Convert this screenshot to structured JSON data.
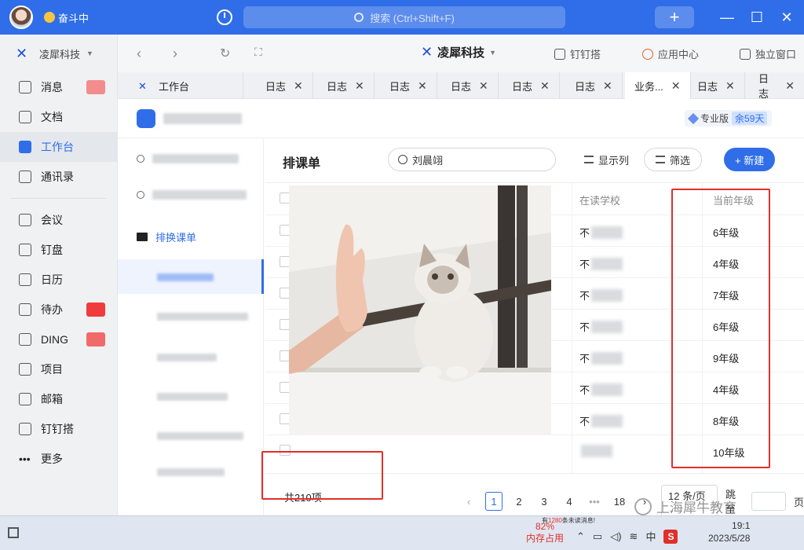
{
  "titlebar": {
    "status": "奋斗中",
    "search_placeholder": "搜索 (Ctrl+Shift+F)",
    "plus": "+",
    "minimize": "—",
    "maximize": "☐",
    "close": "✕"
  },
  "leftnav": {
    "org": "凌犀科技",
    "items": [
      {
        "label": "消息"
      },
      {
        "label": "文档"
      },
      {
        "label": "工作台"
      },
      {
        "label": "通讯录"
      },
      {
        "label": "会议"
      },
      {
        "label": "钉盘"
      },
      {
        "label": "日历"
      },
      {
        "label": "待办"
      },
      {
        "label": "DING"
      },
      {
        "label": "项目"
      },
      {
        "label": "邮箱"
      },
      {
        "label": "钉钉搭"
      },
      {
        "label": "更多"
      }
    ]
  },
  "toprow": {
    "brand": "凌犀科技",
    "links": [
      "钉钉搭",
      "应用中心",
      "独立窗口"
    ]
  },
  "tabs": {
    "home": "工作台",
    "items": [
      "日志",
      "日志",
      "日志",
      "日志",
      "日志",
      "日志",
      "业务...",
      "日志",
      "日志"
    ]
  },
  "app": {
    "edition": "专业版",
    "days_left": "余59天"
  },
  "tree": {
    "folder_label": "排换课单"
  },
  "pane": {
    "title": "排课单",
    "search_value": "刘晨翊",
    "show_columns": "显示列",
    "filter": "筛选",
    "new": "+ 新建",
    "col_school": "在读学校",
    "col_grade": "当前年级",
    "rows": [
      {
        "school": "不",
        "grade": "6年级"
      },
      {
        "school": "不",
        "grade": "4年级"
      },
      {
        "school": "不",
        "grade": "7年级"
      },
      {
        "school": "不",
        "grade": "6年级"
      },
      {
        "school": "不",
        "grade": "9年级"
      },
      {
        "school": "不",
        "grade": "4年级"
      },
      {
        "school": "不",
        "grade": "8年级"
      },
      {
        "school": "",
        "grade": "10年级"
      }
    ]
  },
  "footer": {
    "total": "共210项",
    "pages": [
      "1",
      "2",
      "3",
      "4",
      "•••",
      "18"
    ],
    "page_size": "12 条/页",
    "jump_label": "跳至",
    "page_suffix": "页"
  },
  "taskbar": {
    "memory_pct": "82%",
    "memory_label": "内存占用",
    "unread_msg_prefix": "有",
    "unread_count": "1280",
    "unread_msg_suffix": "条未读消息!",
    "ime": "中",
    "time": "19:1",
    "date": "2023/5/28"
  },
  "watermark": "上海犀牛教育",
  "colors": {
    "accent": "#2f6ee8",
    "highlight": "#e0302b"
  }
}
